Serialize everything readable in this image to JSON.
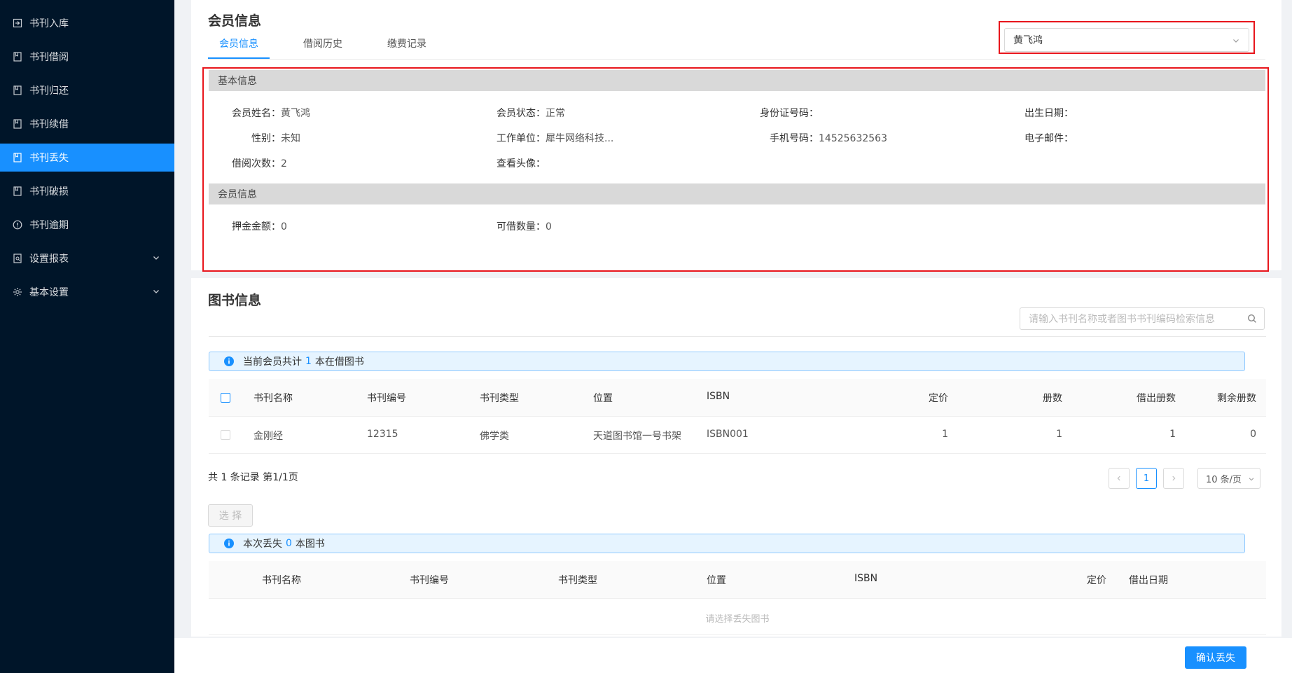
{
  "sidebar": {
    "items": [
      {
        "label": "书刊入库",
        "icon": "import-icon"
      },
      {
        "label": "书刊借阅",
        "icon": "book-icon"
      },
      {
        "label": "书刊归还",
        "icon": "book-icon"
      },
      {
        "label": "书刊续借",
        "icon": "book-icon"
      },
      {
        "label": "书刊丢失",
        "icon": "book-icon",
        "active": true
      },
      {
        "label": "书刊破损",
        "icon": "book-icon"
      },
      {
        "label": "书刊逾期",
        "icon": "info-circle-icon"
      },
      {
        "label": "设置报表",
        "icon": "report-icon",
        "expandable": true
      },
      {
        "label": "基本设置",
        "icon": "gear-icon",
        "expandable": true
      }
    ]
  },
  "member": {
    "title": "会员信息",
    "tabs": [
      "会员信息",
      "借阅历史",
      "缴费记录"
    ],
    "selected_member": "黄飞鸿",
    "basic_header": "基本信息",
    "fields": {
      "name_label": "会员姓名：",
      "name_value": "黄飞鸿",
      "status_label": "会员状态：",
      "status_value": "正常",
      "id_label": "身份证号码：",
      "id_value": "",
      "birth_label": "出生日期：",
      "birth_value": "",
      "gender_label": "性别：",
      "gender_value": "未知",
      "work_label": "工作单位：",
      "work_value": "犀牛网络科技...",
      "phone_label": "手机号码：",
      "phone_value": "14525632563",
      "email_label": "电子邮件：",
      "email_value": "",
      "borrow_count_label": "借阅次数：",
      "borrow_count_value": "2",
      "avatar_label": "查看头像：",
      "avatar_value": ""
    },
    "membership_header": "会员信息",
    "membership": {
      "deposit_label": "押金金额：",
      "deposit_value": "0",
      "quota_label": "可借数量：",
      "quota_value": "0"
    }
  },
  "books": {
    "title": "图书信息",
    "search_placeholder": "请输入书刊名称或者图书书刊编码检索信息",
    "notice_prefix": "当前会员共计",
    "notice_count": "1",
    "notice_suffix": "本在借图书",
    "columns": [
      "书刊名称",
      "书刊编号",
      "书刊类型",
      "位置",
      "ISBN",
      "定价",
      "册数",
      "借出册数",
      "剩余册数"
    ],
    "rows": [
      {
        "name": "金刚经",
        "code": "12315",
        "type": "佛学类",
        "location": "天道图书馆一号书架",
        "isbn": "ISBN001",
        "price": "1",
        "copies": "1",
        "borrowed": "1",
        "remaining": "0"
      }
    ],
    "total_text": "共 1 条记录 第1/1页",
    "current_page": "1",
    "page_size": "10 条/页",
    "select_button": "选 择"
  },
  "lost": {
    "notice_prefix": "本次丢失",
    "notice_count": "0",
    "notice_suffix": "本图书",
    "columns": [
      "书刊名称",
      "书刊编号",
      "书刊类型",
      "位置",
      "ISBN",
      "定价",
      "借出日期"
    ],
    "empty_text": "请选择丢失图书",
    "confirm_button": "确认丢失"
  },
  "colors": {
    "sidebar_bg": "#001529",
    "accent": "#1890ff",
    "highlight_border": "#e8161c"
  }
}
